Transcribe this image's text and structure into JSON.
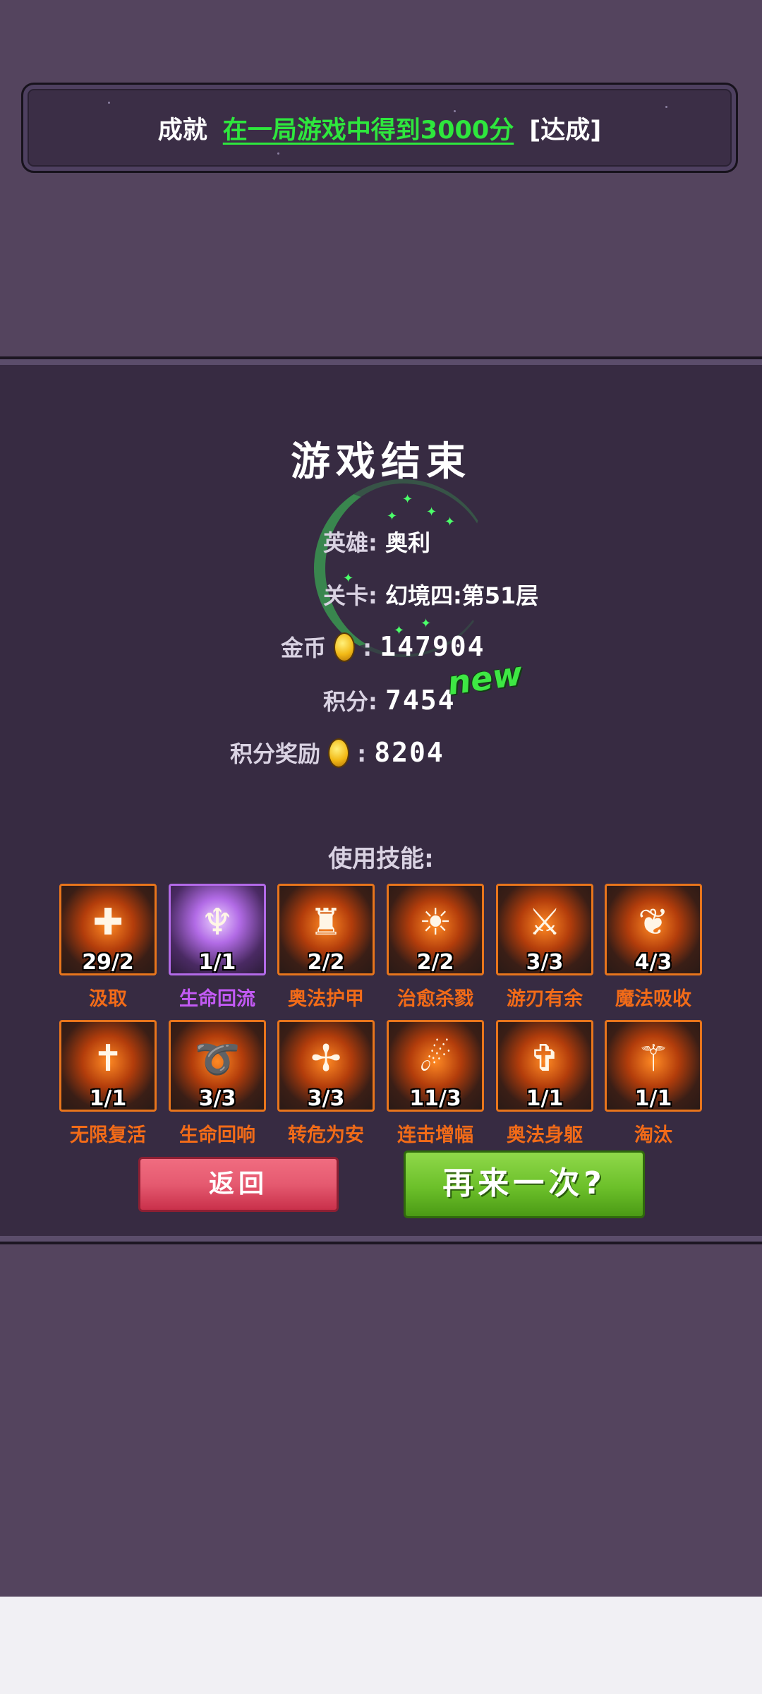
{
  "achievement": {
    "label": "成就",
    "text": "在一局游戏中得到3000分",
    "status": "[达成]"
  },
  "result": {
    "title": "游戏结束",
    "hero_label": "英雄:",
    "hero_value": "奥利",
    "stage_label": "关卡:",
    "stage_value": "幻境四:第51层",
    "gold_label": "金币",
    "gold_value": "147904",
    "score_label": "积分:",
    "score_value": "7454",
    "new_badge": "new",
    "reward_label": "积分奖励",
    "reward_value": "8204",
    "colon": ":"
  },
  "skills_label": "使用技能:",
  "skills": [
    {
      "name": "汲取",
      "count": "29/2",
      "icon": "cross-shield-icon"
    },
    {
      "name": "生命回流",
      "count": "1/1",
      "icon": "praying-figure-icon"
    },
    {
      "name": "奥法护甲",
      "count": "2/2",
      "icon": "armored-figure-icon"
    },
    {
      "name": "治愈杀戮",
      "count": "2/2",
      "icon": "radiant-figure-icon"
    },
    {
      "name": "游刃有余",
      "count": "3/3",
      "icon": "sword-swirl-icon"
    },
    {
      "name": "魔法吸收",
      "count": "4/3",
      "icon": "winged-emblem-icon"
    },
    {
      "name": "无限复活",
      "count": "1/1",
      "icon": "ankh-cross-icon"
    },
    {
      "name": "生命回响",
      "count": "3/3",
      "icon": "flexed-arm-icon"
    },
    {
      "name": "转危为安",
      "count": "3/3",
      "icon": "dash-plus-icon"
    },
    {
      "name": "连击增幅",
      "count": "11/3",
      "icon": "running-figure-icon"
    },
    {
      "name": "奥法身躯",
      "count": "1/1",
      "icon": "winged-cross-icon"
    },
    {
      "name": "淘汰",
      "count": "1/1",
      "icon": "slash-emblem-icon"
    }
  ],
  "buttons": {
    "back": "返回",
    "retry": "再来一次?"
  },
  "colors": {
    "background": "#54445e",
    "panel": "#372b42",
    "achievement_green": "#2ee73d",
    "skill_orange": "#f26b18",
    "skill_purple": "#c35af5"
  }
}
